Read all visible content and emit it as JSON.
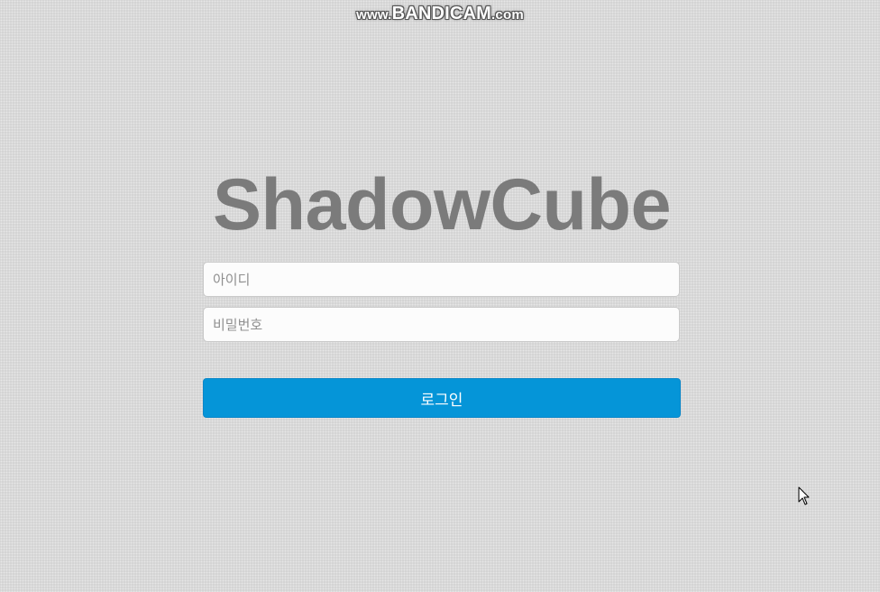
{
  "watermark": {
    "prefix": "www.",
    "brand": "BANDICAM",
    "suffix": ".com"
  },
  "login": {
    "title": "ShadowCube",
    "id_placeholder": "아이디",
    "password_placeholder": "비밀번호",
    "id_value": "",
    "password_value": "",
    "submit_label": "로그인"
  },
  "colors": {
    "background": "#d9d9d9",
    "title": "#7b7b7b",
    "button": "#0595d8",
    "button_text": "#ffffff"
  },
  "icons": {
    "cursor": "mouse-pointer-icon"
  }
}
